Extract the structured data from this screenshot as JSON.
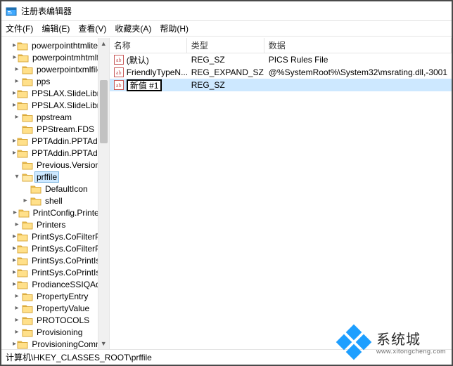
{
  "title": "注册表编辑器",
  "menu": {
    "file": "文件(F)",
    "edit": "编辑(E)",
    "view": "查看(V)",
    "fav": "收藏夹(A)",
    "help": "帮助(H)"
  },
  "tree": [
    {
      "ind": 1,
      "tw": ">",
      "label": "powerpointhtmlitem",
      "tail": "∧"
    },
    {
      "ind": 1,
      "tw": ">",
      "label": "powerpointmhtmlfile"
    },
    {
      "ind": 1,
      "tw": ">",
      "label": "powerpointxmlfile"
    },
    {
      "ind": 1,
      "tw": ">",
      "label": "pps"
    },
    {
      "ind": 1,
      "tw": ">",
      "label": "PPSLAX.SlideLibrary"
    },
    {
      "ind": 1,
      "tw": ">",
      "label": "PPSLAX.SlideLibrary"
    },
    {
      "ind": 1,
      "tw": ">",
      "label": "ppstream"
    },
    {
      "ind": 1,
      "tw": "",
      "label": "PPStream.FDS"
    },
    {
      "ind": 1,
      "tw": ">",
      "label": "PPTAddin.PPTAddin"
    },
    {
      "ind": 1,
      "tw": ">",
      "label": "PPTAddin.PPTAddin"
    },
    {
      "ind": 1,
      "tw": "",
      "label": "Previous.Versions"
    },
    {
      "ind": 1,
      "tw": "v",
      "label": "prffile",
      "sel": true
    },
    {
      "ind": 2,
      "tw": "",
      "label": "DefaultIcon"
    },
    {
      "ind": 2,
      "tw": ">",
      "label": "shell"
    },
    {
      "ind": 1,
      "tw": ">",
      "label": "PrintConfig.PrinterE"
    },
    {
      "ind": 1,
      "tw": ">",
      "label": "Printers"
    },
    {
      "ind": 1,
      "tw": ">",
      "label": "PrintSys.CoFilterPipe"
    },
    {
      "ind": 1,
      "tw": ">",
      "label": "PrintSys.CoFilterPipe"
    },
    {
      "ind": 1,
      "tw": ">",
      "label": "PrintSys.CoPrintIsola"
    },
    {
      "ind": 1,
      "tw": ">",
      "label": "PrintSys.CoPrintIsola"
    },
    {
      "ind": 1,
      "tw": ">",
      "label": "ProdianceSSIQAddI"
    },
    {
      "ind": 1,
      "tw": ">",
      "label": "PropertyEntry"
    },
    {
      "ind": 1,
      "tw": ">",
      "label": "PropertyValue"
    },
    {
      "ind": 1,
      "tw": ">",
      "label": "PROTOCOLS"
    },
    {
      "ind": 1,
      "tw": ">",
      "label": "Provisioning"
    },
    {
      "ind": 1,
      "tw": ">",
      "label": "ProvisioningComma"
    }
  ],
  "columns": {
    "name": "名称",
    "type": "类型",
    "data": "数据"
  },
  "rows": [
    {
      "name": "(默认)",
      "type": "REG_SZ",
      "data": "PICS Rules File",
      "sel": false,
      "edit": false
    },
    {
      "name": "FriendlyTypeN...",
      "type": "REG_EXPAND_SZ",
      "data": "@%SystemRoot%\\System32\\msrating.dll,-3001",
      "sel": false,
      "edit": false
    },
    {
      "name": "新值 #1",
      "type": "REG_SZ",
      "data": "",
      "sel": true,
      "edit": true
    }
  ],
  "status": "计算机\\HKEY_CLASSES_ROOT\\prffile",
  "watermark": {
    "brand": "系统城",
    "sub": "www.xitongcheng.com"
  }
}
